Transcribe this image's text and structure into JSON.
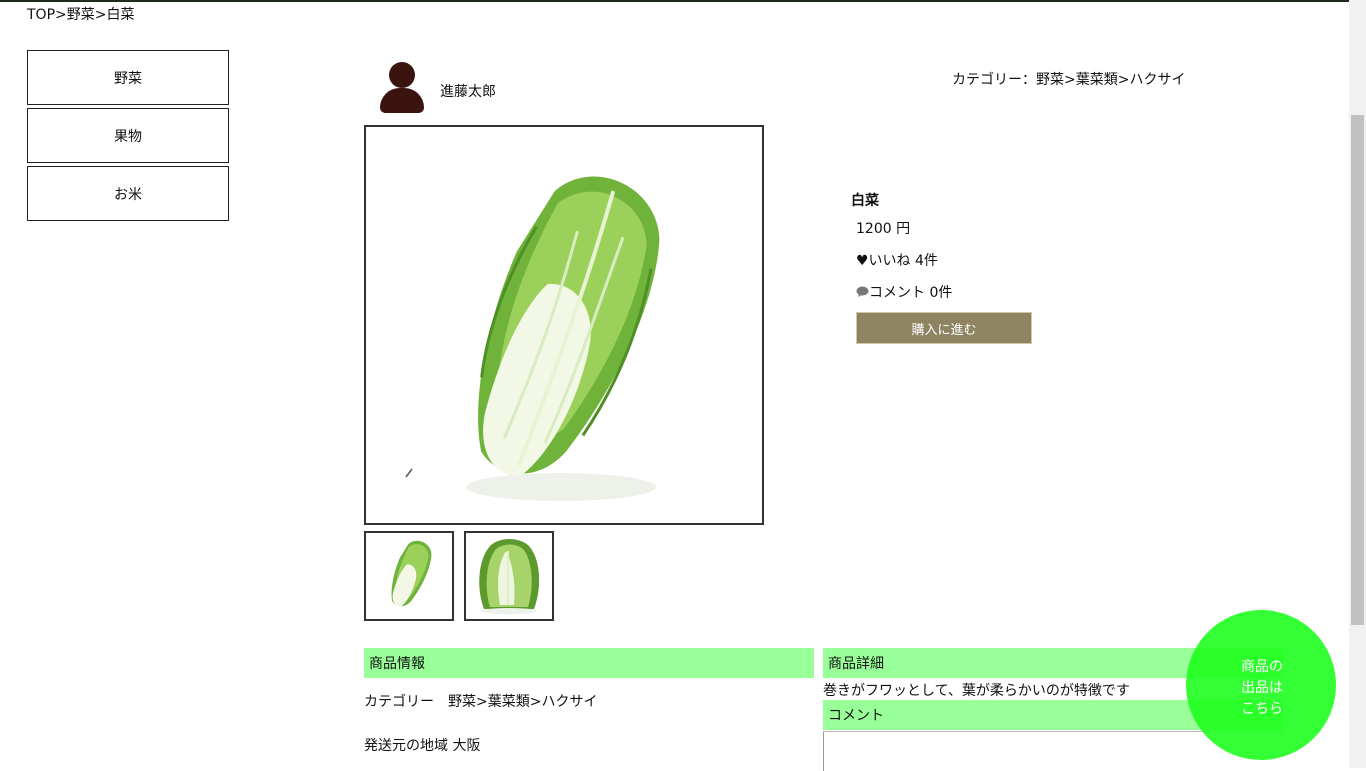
{
  "breadcrumb": "TOP>野菜>白菜",
  "sidebar": {
    "items": [
      {
        "label": "野菜"
      },
      {
        "label": "果物"
      },
      {
        "label": "お米"
      }
    ]
  },
  "seller": {
    "name": "進藤太郎",
    "icon": "user-icon"
  },
  "category_top": "カテゴリー：野菜>葉菜類>ハクサイ",
  "product": {
    "name": "白菜",
    "price": "1200 円",
    "likes": "♥いいね 4件",
    "comments": "コメント 0件",
    "buy_label": "購入に進む"
  },
  "sections": {
    "info_title": "商品情報",
    "category_line": "カテゴリー　野菜>葉菜類>ハクサイ",
    "region_line": "発送元の地域 大阪",
    "detail_title": "商品詳細",
    "detail_text": "巻きがフワッとして、葉が柔らかいのが特徴です",
    "comment_title": "コメント"
  },
  "fab": {
    "line1": "商品の",
    "line2": "出品は",
    "line3": "こちら"
  },
  "colors": {
    "section": "#99ff99",
    "button": "#8e8462",
    "fab": "#1eff1e",
    "avatar": "#3b1410"
  }
}
